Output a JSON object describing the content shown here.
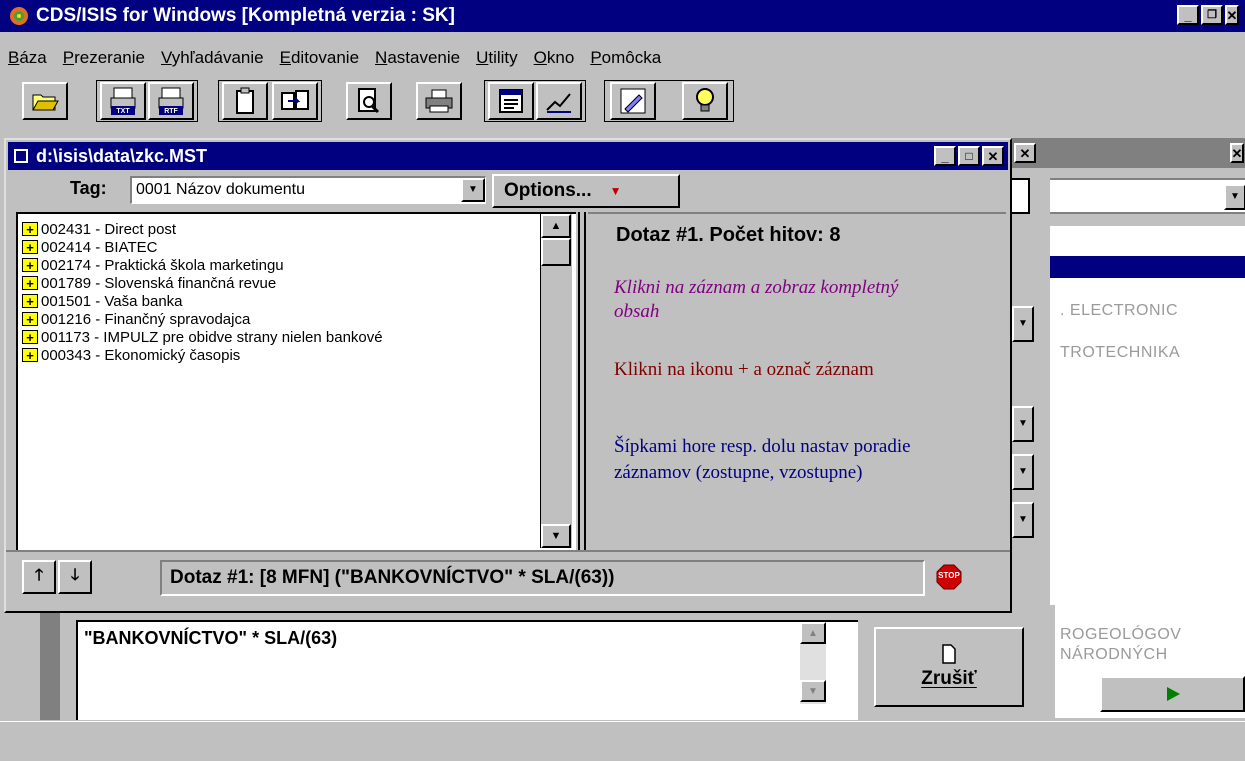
{
  "app": {
    "title": "CDS/ISIS for Windows [Kompletná verzia : SK]",
    "title_bar_color": "#000080"
  },
  "menu": [
    {
      "label": "Báza",
      "ul": "B",
      "rest": "áza"
    },
    {
      "label": "Prezeranie",
      "ul": "P",
      "rest": "rezeranie"
    },
    {
      "label": "Vyhľadávanie",
      "ul": "V",
      "rest": "yhľadávanie"
    },
    {
      "label": "Editovanie",
      "ul": "E",
      "rest": "ditovanie"
    },
    {
      "label": "Nastavenie",
      "ul": "N",
      "rest": "astavenie"
    },
    {
      "label": "Utility",
      "ul": "U",
      "rest": "tility"
    },
    {
      "label": "Okno",
      "ul": "O",
      "rest": "kno"
    },
    {
      "label": "Pomôcka",
      "ul": "P",
      "rest": "omôcka"
    }
  ],
  "toolbar": {
    "icons": [
      "open-folder-icon",
      "export-txt-icon",
      "export-rtf-icon",
      "clipboard-icon",
      "copy-records-icon",
      "print-preview-icon",
      "printer-icon",
      "form-icon",
      "edit-chart-icon",
      "pencil-icon",
      "lightbulb-icon"
    ],
    "txt_label": "TXT",
    "rtf_label": "RTF"
  },
  "mst_window": {
    "title": "d:\\isis\\data\\zkc.MST",
    "tag_label": "Tag:",
    "tag_value": "0001 Názov dokumentu",
    "options_label": "Options...",
    "records": [
      {
        "mfn": "002431",
        "title": "Direct post"
      },
      {
        "mfn": "002414",
        "title": "BIATEC"
      },
      {
        "mfn": "002174",
        "title": "Praktická škola marketingu"
      },
      {
        "mfn": "001789",
        "title": "Slovenská finančná revue"
      },
      {
        "mfn": "001501",
        "title": "Vaša banka"
      },
      {
        "mfn": "001216",
        "title": "Finančný spravodajca"
      },
      {
        "mfn": "001173",
        "title": "IMPULZ pre obidve strany nielen bankové"
      },
      {
        "mfn": "000343",
        "title": "Ekonomický časopis"
      }
    ],
    "info": {
      "heading": "Dotaz #1. Počet hitov: 8",
      "hint1": "Klikni na záznam a zobraz kompletný obsah",
      "hint2": "Klikni na ikonu + a označ záznam",
      "hint3": "Šípkami hore resp. dolu nastav poradie záznamov (zostupne, vzostupne)",
      "hint1_color": "#800080",
      "hint2_color": "#800000",
      "hint3_color": "#000080"
    },
    "status_query": "Dotaz #1: [8 MFN] (\"BANKOVNÍCTVO\" * SLA/(63))",
    "stop_label": "STOP"
  },
  "search_panel": {
    "query_text": "\"BANKOVNÍCTVO\" * SLA/(63)",
    "cancel_label": "Zrušiť"
  },
  "background_window": {
    "items": [
      ". ELECTRONIC",
      "TROTECHNIKA",
      "ROGEOLÓGOV",
      "NÁRODNÝCH"
    ]
  }
}
